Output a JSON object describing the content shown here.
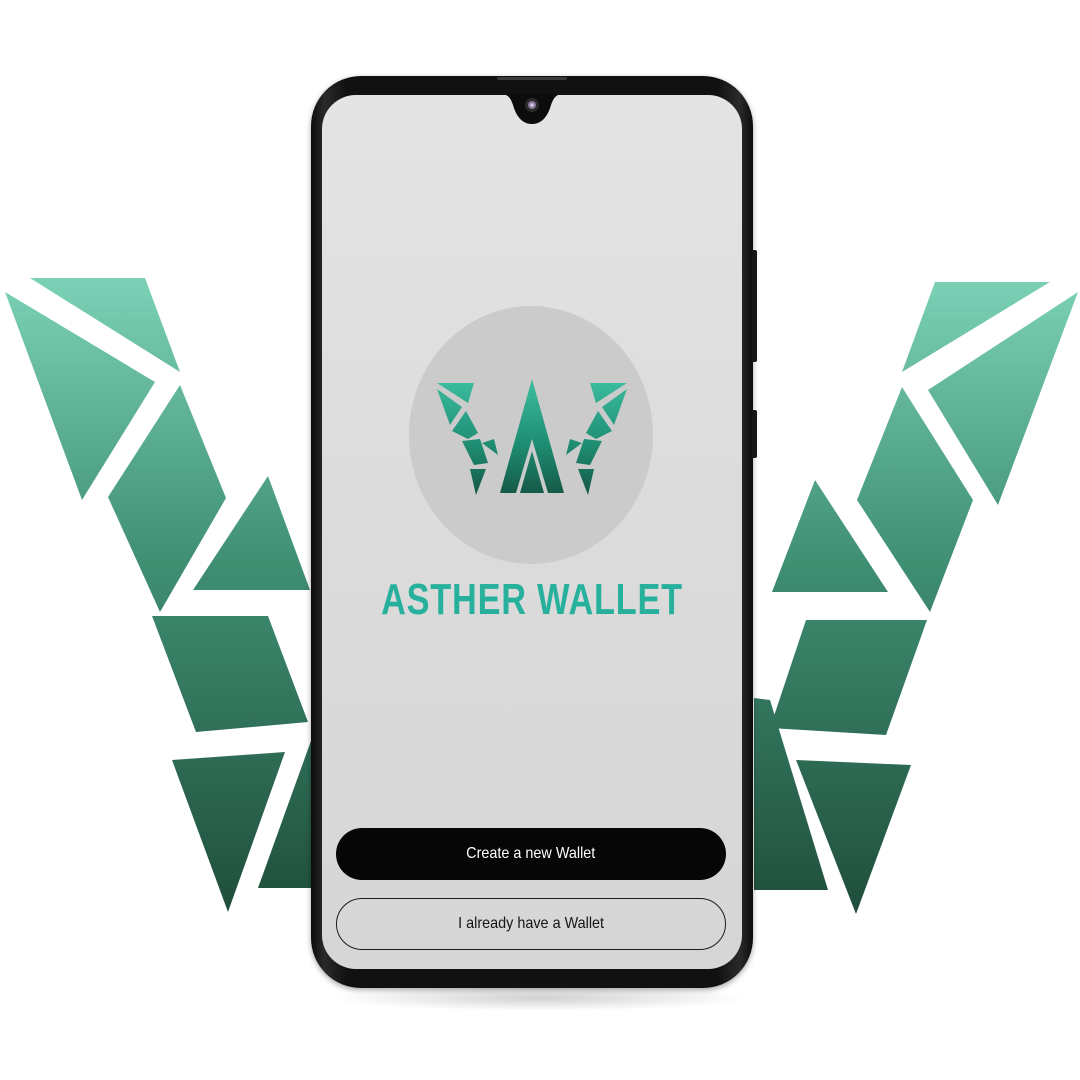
{
  "brand": {
    "name": "ASTHER WALLET",
    "accent_color": "#27b19c",
    "backdrop_gradient": [
      "#7dd3b8",
      "#22533f"
    ]
  },
  "actions": {
    "create_label": "Create a new Wallet",
    "existing_label": "I already have a Wallet"
  },
  "icons": {
    "logo": "asther-w-logo-icon",
    "camera": "front-camera-icon"
  }
}
